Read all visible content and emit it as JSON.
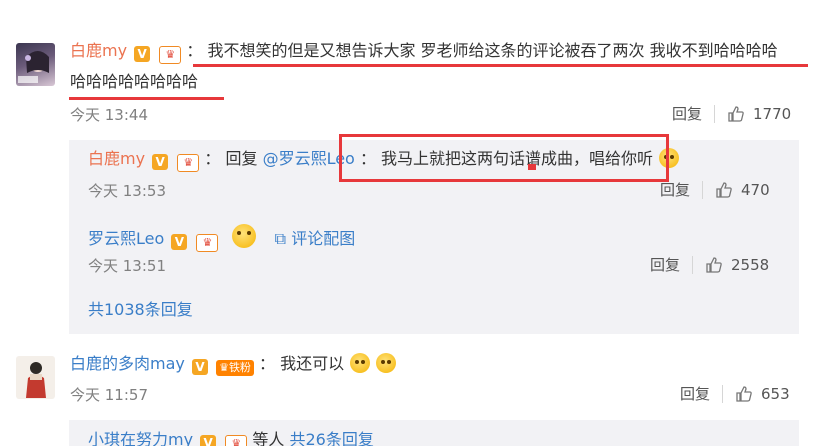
{
  "comments": [
    {
      "user": "白鹿my",
      "colon": "：",
      "text_line1": "我不想笑的但是又想告诉大家 罗老师给这条的评论被吞了两次 我收不到哈哈哈哈",
      "text_line2": "哈哈哈哈哈哈哈哈",
      "time": "今天 13:44",
      "reply_label": "回复",
      "likes": "1770"
    },
    {
      "user": "白鹿的多肉may",
      "fan_badge": "铁粉",
      "colon": "：",
      "text": "我还可以",
      "time": "今天 11:57",
      "reply_label": "回复",
      "likes": "653"
    }
  ],
  "replies": [
    {
      "user": "白鹿my",
      "colon": "：",
      "prefix": "回复",
      "mention": "@罗云熙Leo",
      "colon2": "：",
      "text": "我马上就把这两句话谱成曲，唱给你听",
      "time": "今天 13:53",
      "reply_label": "回复",
      "likes": "470"
    },
    {
      "user": "罗云熙Leo",
      "pic_link": "评论配图",
      "time": "今天 13:51",
      "reply_label": "回复",
      "likes": "2558"
    }
  ],
  "more_replies": "共1038条回复",
  "partial_next": {
    "user": "小琪在努力my",
    "text": "等人",
    "count": "共26条回复"
  },
  "colors": {
    "name_orange": "#eb7350",
    "link_blue": "#3a7ec8",
    "highlight_red": "#e7383b",
    "reply_bg": "#f2f2f5"
  }
}
